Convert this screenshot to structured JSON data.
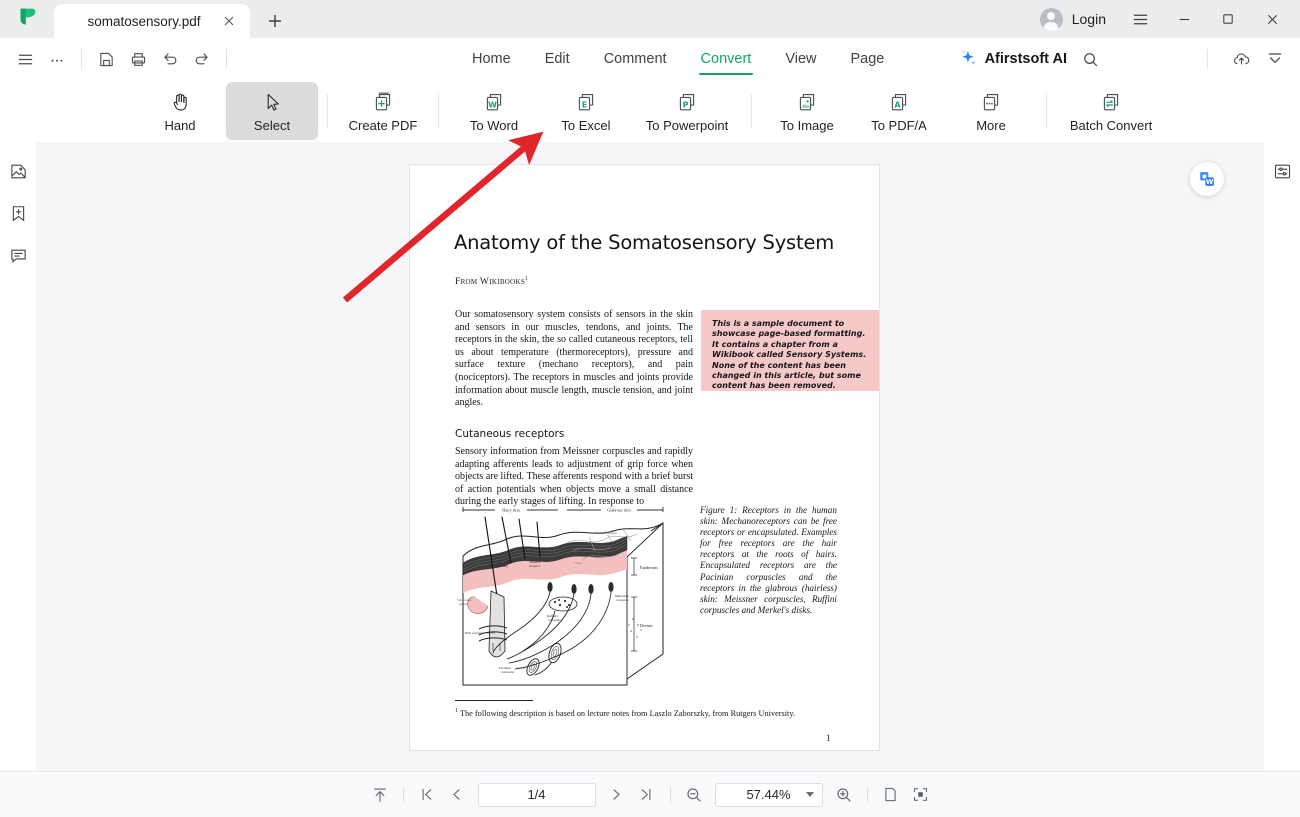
{
  "titlebar": {
    "logo_icon": "afirstsoft-leaf-logo",
    "tab": {
      "title": "somatosensory.pdf",
      "close_icon": "close-icon"
    },
    "new_tab_icon": "plus-icon",
    "login_label": "Login",
    "avatar_icon": "user-avatar-icon",
    "menu_icon": "hamburger-menu-icon",
    "minimize_icon": "minimize-icon",
    "maximize_icon": "maximize-icon",
    "close_icon": "window-close-icon"
  },
  "menubar": {
    "left_icons": [
      {
        "name": "hamburger-menu-icon"
      },
      {
        "name": "more-options-icon"
      },
      {
        "name": "save-icon"
      },
      {
        "name": "print-icon"
      },
      {
        "name": "undo-icon"
      },
      {
        "name": "redo-icon"
      }
    ],
    "tabs": [
      {
        "label": "Home",
        "active": false
      },
      {
        "label": "Edit",
        "active": false
      },
      {
        "label": "Comment",
        "active": false
      },
      {
        "label": "Convert",
        "active": true
      },
      {
        "label": "View",
        "active": false
      },
      {
        "label": "Page",
        "active": false
      }
    ],
    "ai_label": "Afirstsoft AI",
    "ai_icon": "sparkle-icon",
    "search_icon": "search-icon",
    "cloud_icon": "cloud-upload-icon",
    "collapse_icon": "collapse-ribbon-icon",
    "accent_color": "#16a46a"
  },
  "ribbon": {
    "items": [
      {
        "label": "Hand",
        "icon": "hand-icon",
        "selected": false
      },
      {
        "label": "Select",
        "icon": "cursor-select-icon",
        "selected": true
      },
      {
        "label": "Create PDF",
        "icon": "create-pdf-icon",
        "selected": false
      },
      {
        "label": "To Word",
        "icon": "to-word-icon",
        "selected": false
      },
      {
        "label": "To Excel",
        "icon": "to-excel-icon",
        "selected": false
      },
      {
        "label": "To Powerpoint",
        "icon": "to-powerpoint-icon",
        "selected": false
      },
      {
        "label": "To Image",
        "icon": "to-image-icon",
        "selected": false
      },
      {
        "label": "To PDF/A",
        "icon": "to-pdfa-icon",
        "selected": false
      },
      {
        "label": "More",
        "icon": "more-convert-icon",
        "selected": false
      },
      {
        "label": "Batch Convert",
        "icon": "batch-convert-icon",
        "selected": false
      }
    ]
  },
  "left_rail": {
    "items": [
      {
        "name": "thumbnails-icon"
      },
      {
        "name": "bookmark-add-icon"
      },
      {
        "name": "comments-icon"
      }
    ]
  },
  "right_rail": {
    "items": [
      {
        "name": "properties-panel-icon"
      }
    ]
  },
  "viewer": {
    "fab_icon": "convert-to-word-fab-icon",
    "annotation": {
      "name": "red-arrow-annotation",
      "color": "#e0262b"
    }
  },
  "document": {
    "title": "Anatomy of the Somatosensory System",
    "source": "From Wikibooks",
    "source_footnote_marker": "1",
    "paragraph1": "Our somatosensory system consists of sensors in the skin and sensors in our muscles, tendons, and joints. The receptors in the skin, the so called cutaneous receptors, tell us about temperature (thermoreceptors), pressure and surface texture (mechano receptors), and pain (nociceptors). The receptors in muscles and joints provide information about muscle length, muscle tension, and joint angles.",
    "heading2": "Cutaneous receptors",
    "paragraph2": "Sensory information from Meissner corpuscles and rapidly adapting afferents leads to adjustment of grip force when objects are lifted. These afferents respond with a brief burst of action potentials when objects move a small distance during the early stages of lifting. In response to",
    "callout": "This is a sample document to showcase page-based formatting. It contains a chapter from a Wikibook called Sensory Systems. None of the content has been changed in this article, but some content has been removed.",
    "figure_caption": "Figure 1: Receptors in the human skin: Mechanoreceptors can be free receptors or encapsulated. Examples for free receptors are the hair receptors at the roots of hairs. Encapsulated receptors are the Pacinian corpuscles and the receptors in the glabrous (hairless) skin: Meissner corpuscles, Ruffini corpuscles and Merkel's disks.",
    "figure_labels": {
      "hairy_skin": "Hairy skin",
      "glabrous_skin": "Glabrous skin",
      "papillary_ridges": "Papillary Ridges",
      "epidermis": "Epidermis",
      "dermis": "Dermis",
      "free_nerve_ending": "Free nerve ending",
      "merkel_receptor": "Merkel's receptor",
      "meissner_corpuscle": "Meissner's corpuscle",
      "ruffini_corpuscle": "Ruffini's corpuscle",
      "sebaceous_gland": "Sebaceous gland",
      "hair_receptor": "Hair receptor",
      "pacinian_corpuscle": "Pacinian corpuscle",
      "septa": "Septa"
    },
    "footnote_marker": "1",
    "footnote": "The following description is based on lecture notes from Laszlo Zaborszky, from Rutgers University.",
    "page_number": "1",
    "callout_bg": "#f6c8c8"
  },
  "statusbar": {
    "fit_icon": "scroll-to-top-icon",
    "first_page_icon": "first-page-icon",
    "prev_page_icon": "previous-page-icon",
    "page_value": "1/4",
    "next_page_icon": "next-page-icon",
    "last_page_icon": "last-page-icon",
    "zoom_out_icon": "zoom-out-icon",
    "zoom_value": "57.44%",
    "zoom_dropdown_icon": "chevron-down-icon",
    "zoom_in_icon": "zoom-in-icon",
    "single_page_icon": "single-page-view-icon",
    "fit_page_icon": "fit-page-icon"
  }
}
